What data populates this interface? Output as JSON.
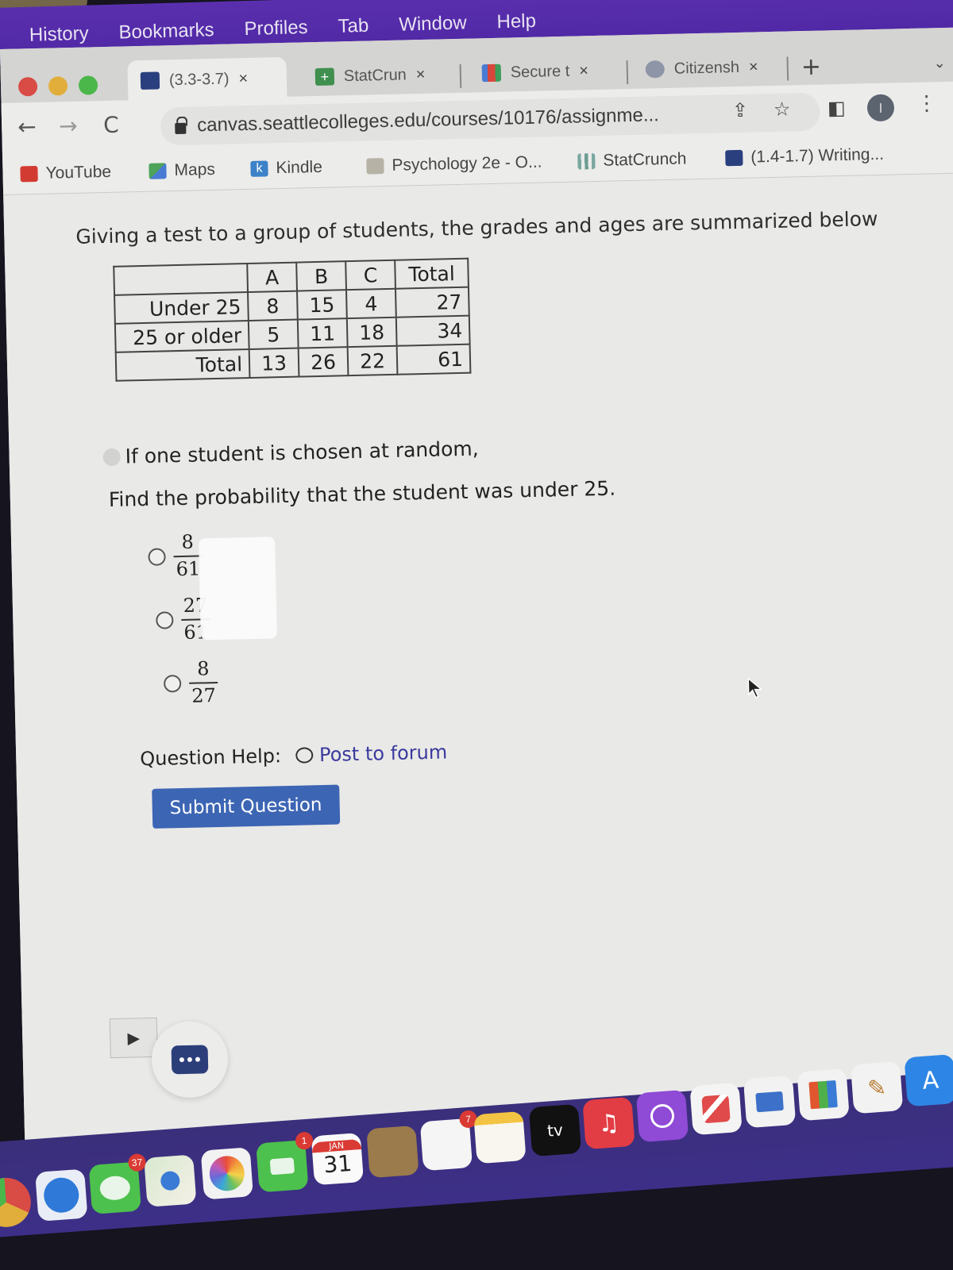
{
  "menubar": {
    "items": [
      "History",
      "Bookmarks",
      "Profiles",
      "Tab",
      "Window",
      "Help"
    ]
  },
  "tabs": [
    {
      "title": "(3.3-3.7)",
      "icon": "canvas-icon",
      "active": true,
      "close": "×"
    },
    {
      "title": "StatCrun",
      "icon": "statcrunch-icon",
      "active": false,
      "close": "×"
    },
    {
      "title": "Secure t",
      "icon": "gmail-icon",
      "active": false,
      "close": "×"
    },
    {
      "title": "Citizensh",
      "icon": "uscis-icon",
      "active": false,
      "close": "×"
    }
  ],
  "new_tab": "+",
  "tab_menu_chevron": "⌄",
  "toolbar": {
    "back": "←",
    "forward": "→",
    "reload": "C",
    "url": "canvas.seattlecolleges.edu/courses/10176/assignme...",
    "share": "⇪",
    "star": "☆",
    "sidepanel": "◧",
    "profile_initial": "I",
    "menu": "⋮"
  },
  "bookmarks": [
    {
      "label": "YouTube",
      "icon": "youtube-icon"
    },
    {
      "label": "Maps",
      "icon": "maps-icon"
    },
    {
      "label": "Kindle",
      "icon": "kindle-icon"
    },
    {
      "label": "Psychology 2e - O...",
      "icon": "book-icon"
    },
    {
      "label": "StatCrunch",
      "icon": "statcrunch-icon"
    },
    {
      "label": "(1.4-1.7) Writing...",
      "icon": "canvas-icon"
    }
  ],
  "question": {
    "intro": "Giving a test to a group of students, the grades and ages are summarized below",
    "table": {
      "headers": [
        "",
        "A",
        "B",
        "C",
        "Total"
      ],
      "rows": [
        {
          "label": "Under 25",
          "values": [
            "8",
            "15",
            "4",
            "27"
          ]
        },
        {
          "label": "25 or older",
          "values": [
            "5",
            "11",
            "18",
            "34"
          ]
        },
        {
          "label": "Total",
          "values": [
            "13",
            "26",
            "22",
            "61"
          ]
        }
      ]
    },
    "prompt_line1": "If one student is chosen at random,",
    "prompt_line2": "Find the probability that the student was under 25.",
    "options": [
      {
        "numerator": "8",
        "denominator": "61",
        "selected": false
      },
      {
        "numerator": "27",
        "denominator": "61",
        "selected": false
      },
      {
        "numerator": "8",
        "denominator": "27",
        "selected": false
      }
    ],
    "help_label": "Question Help:",
    "forum_link": "Post to forum",
    "submit_label": "Submit Question"
  },
  "side_toggle": "▶",
  "dock": {
    "items": [
      {
        "name": "chrome",
        "badge": null
      },
      {
        "name": "safari",
        "badge": null
      },
      {
        "name": "messages",
        "badge": "37"
      },
      {
        "name": "maps",
        "badge": null
      },
      {
        "name": "photos",
        "badge": null
      },
      {
        "name": "facetime",
        "badge": "1"
      },
      {
        "name": "calendar",
        "badge": null,
        "month": "JAN",
        "day": "31"
      },
      {
        "name": "contacts",
        "badge": null
      },
      {
        "name": "reminders",
        "badge": "7"
      },
      {
        "name": "notes",
        "badge": null
      },
      {
        "name": "apple-tv",
        "badge": null,
        "label": "tv"
      },
      {
        "name": "music",
        "badge": null
      },
      {
        "name": "podcasts",
        "badge": null
      },
      {
        "name": "news",
        "badge": null
      },
      {
        "name": "keynote",
        "badge": null
      },
      {
        "name": "numbers",
        "badge": null
      },
      {
        "name": "pages",
        "badge": null
      },
      {
        "name": "app-store",
        "badge": null
      }
    ]
  }
}
